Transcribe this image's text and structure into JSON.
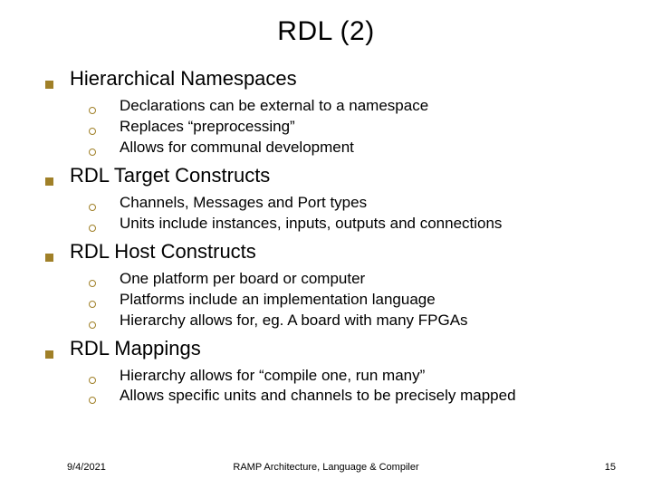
{
  "title": "RDL (2)",
  "sections": [
    {
      "heading": "Hierarchical Namespaces",
      "items": [
        "Declarations can be external to a namespace",
        "Replaces “preprocessing”",
        "Allows for communal development"
      ]
    },
    {
      "heading": "RDL Target Constructs",
      "items": [
        "Channels, Messages and Port types",
        "Units include instances, inputs, outputs and connections"
      ]
    },
    {
      "heading": "RDL Host Constructs",
      "items": [
        "One platform per board or computer",
        "Platforms include an implementation language",
        "Hierarchy allows for, eg. A board with many FPGAs"
      ]
    },
    {
      "heading": "RDL Mappings",
      "items": [
        "Hierarchy allows for “compile one, run many”",
        "Allows specific units and channels to be precisely mapped"
      ]
    }
  ],
  "footer": {
    "date": "9/4/2021",
    "center": "RAMP Architecture, Language & Compiler",
    "page": "15"
  }
}
